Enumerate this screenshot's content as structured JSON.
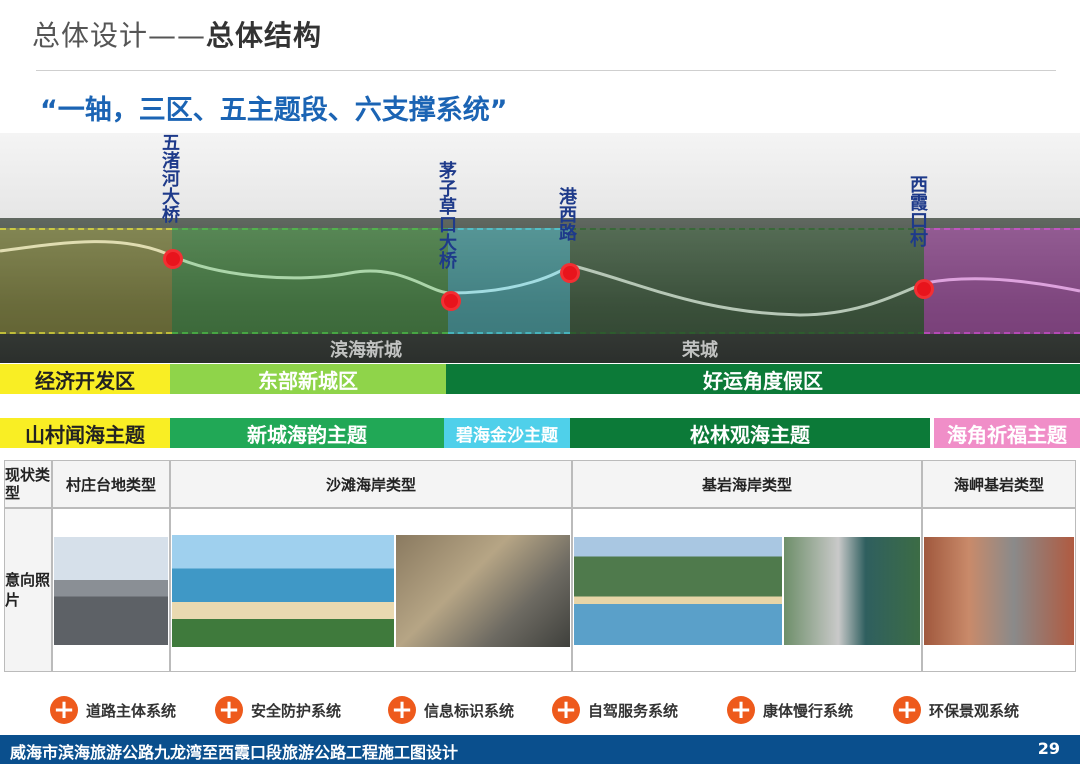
{
  "header": {
    "title_a": "总体设计——",
    "title_b": "总体结构",
    "subtitle": "“一轴，三区、五主题段、六支撑系统”"
  },
  "map": {
    "labels": [
      {
        "text": "五渚河大桥"
      },
      {
        "text": "茅子草口大桥"
      },
      {
        "text": "港西路"
      },
      {
        "text": "西霞口村"
      }
    ],
    "place_names": [
      "滨海新城",
      "荣城"
    ],
    "overlay_colors": {
      "yellow": "#f5ef3c",
      "green": "#4fd14a",
      "cyan": "#4fe2ef",
      "dark": "#3a8a3a",
      "pink": "#e650e6"
    }
  },
  "zones": [
    {
      "label": "经济开发区",
      "color": "#f9ee24",
      "text_color": "#222"
    },
    {
      "label": "东部新城区",
      "color": "#8fd44a",
      "text_color": "#fff"
    },
    {
      "label": "好运角度假区",
      "color": "#0c7a38",
      "text_color": "#fff"
    }
  ],
  "themes": [
    {
      "label": "山村闻海主题",
      "color": "#f9ee24",
      "text_color": "#222"
    },
    {
      "label": "新城海韵主题",
      "color": "#21a856",
      "text_color": "#fff"
    },
    {
      "label": "碧海金沙主题",
      "color": "#4fd0ea",
      "text_color": "#fff"
    },
    {
      "label": "松林观海主题",
      "color": "#0c7a38",
      "text_color": "#fff"
    },
    {
      "label": "海角祈福主题",
      "color": "#f08ec8",
      "text_color": "#fff"
    }
  ],
  "table": {
    "row1_header": "现状类型",
    "row2_header": "意向照片",
    "types": [
      "村庄台地类型",
      "沙滩海岸类型",
      "基岩海岸类型",
      "海岬基岩类型"
    ]
  },
  "systems": [
    "道路主体系统",
    "安全防护系统",
    "信息标识系统",
    "自驾服务系统",
    "康体慢行系统",
    "环保景观系统"
  ],
  "footer": {
    "text": "威海市滨海旅游公路九龙湾至西霞口段旅游公路工程施工图设计",
    "page": "29"
  }
}
